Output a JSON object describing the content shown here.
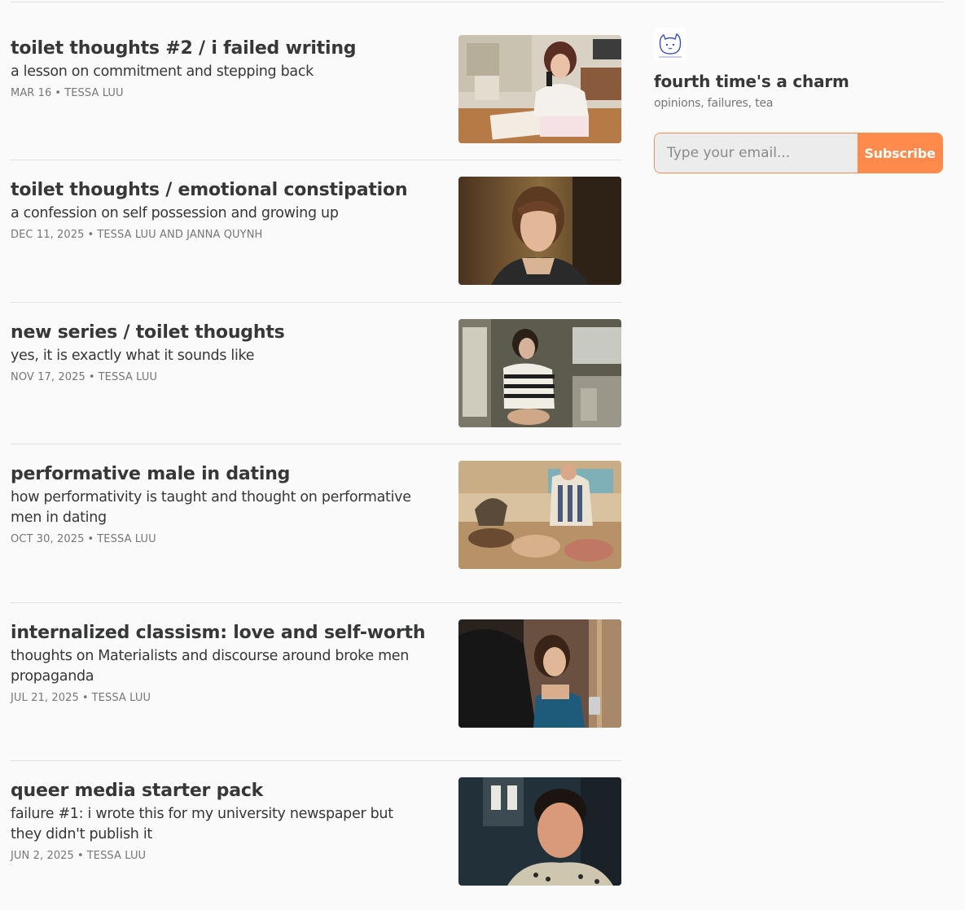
{
  "publication": {
    "name": "fourth time's a charm",
    "description": "opinions, failures, tea",
    "logo_icon": "cat-doodle-logo-icon"
  },
  "subscribe": {
    "placeholder": "Type your email...",
    "button_label": "Subscribe",
    "accent_color": "#ff8a4c"
  },
  "posts": [
    {
      "title": "toilet thoughts #2 / i failed writing",
      "subtitle": "a lesson on commitment and stepping back",
      "date": "MAR 16",
      "authors": "TESSA LUU",
      "thumbnail_icon": "woman-on-phone-at-desk-image"
    },
    {
      "title": "toilet thoughts / emotional constipation",
      "subtitle": "a confession on self possession and growing up",
      "date": "DEC 11, 2025",
      "authors": "TESSA LUU AND JANNA QUYNH",
      "thumbnail_icon": "woman-portrait-image"
    },
    {
      "title": "new series / toilet thoughts",
      "subtitle": "yes, it is exactly what it sounds like",
      "date": "NOV 17, 2025",
      "authors": "TESSA LUU",
      "thumbnail_icon": "woman-in-bathroom-image"
    },
    {
      "title": "performative male in dating",
      "subtitle": "how performativity is taught and thought on performative men in dating",
      "date": "OCT 30, 2025",
      "authors": "TESSA LUU",
      "thumbnail_icon": "vintage-kitchen-illustration-image"
    },
    {
      "title": "internalized classism: love and self-worth",
      "subtitle": "thoughts on Materialists and discourse around broke men propaganda",
      "date": "JUL 21, 2025",
      "authors": "TESSA LUU",
      "thumbnail_icon": "couple-at-party-image"
    },
    {
      "title": "queer media starter pack",
      "subtitle": "failure #1: i wrote this for my university newspaper but they didn't publish it",
      "date": "JUN 2, 2025",
      "authors": "TESSA LUU",
      "thumbnail_icon": "crying-young-man-image"
    }
  ]
}
